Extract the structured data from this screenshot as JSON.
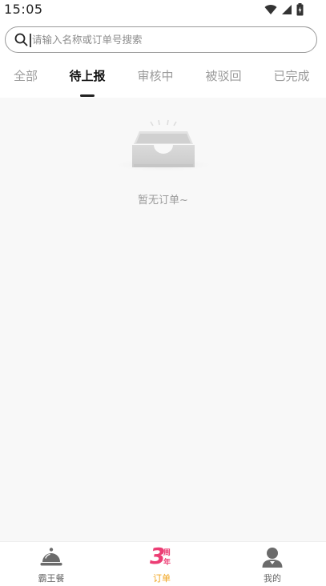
{
  "status_bar": {
    "time": "15:05",
    "icons": [
      "wifi-icon",
      "signal-icon",
      "battery-icon"
    ]
  },
  "search": {
    "value": "",
    "placeholder": "请输入名称或订单号搜索",
    "icon": "search-icon"
  },
  "tabs": [
    {
      "label": "全部",
      "active": false
    },
    {
      "label": "待上报",
      "active": true
    },
    {
      "label": "审核中",
      "active": false
    },
    {
      "label": "被驳回",
      "active": false
    },
    {
      "label": "已完成",
      "active": false
    }
  ],
  "empty_state": {
    "icon": "empty-inbox-icon",
    "text": "暂无订单~"
  },
  "bottom_nav": [
    {
      "label": "霸王餐",
      "icon": "cloche-icon",
      "active": false
    },
    {
      "label": "订单",
      "icon": "anniversary-3-icon",
      "badge_number": "3",
      "badge_text_1": "周",
      "badge_text_2": "年",
      "active": true
    },
    {
      "label": "我的",
      "icon": "user-icon",
      "active": false
    }
  ],
  "colors": {
    "accent": "#f0a31c",
    "badge_pink": "#ec3d74",
    "tab_active": "#111111",
    "tab_inactive": "#9b9b9b",
    "background": "#f8f8f8"
  }
}
